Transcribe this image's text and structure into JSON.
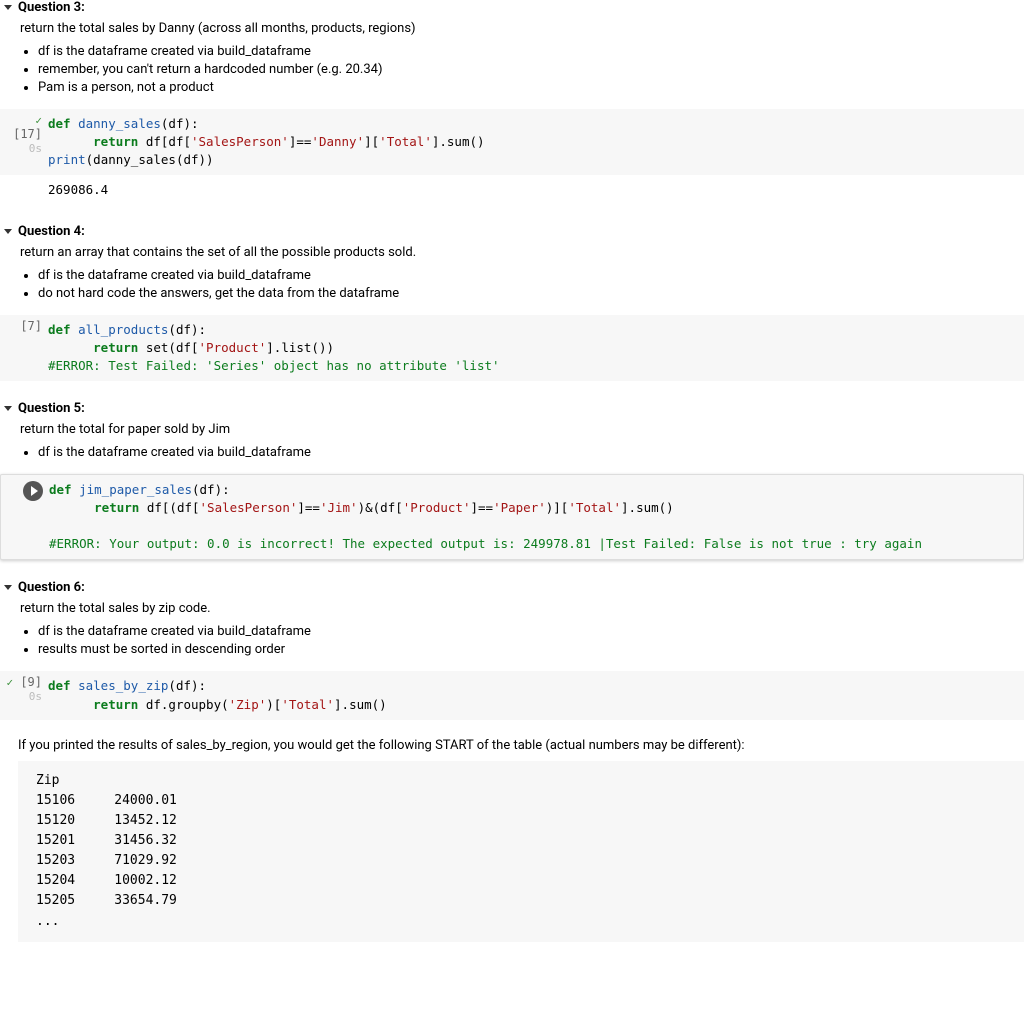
{
  "q3": {
    "title": "Question 3:",
    "desc": "return the total sales by Danny (across all months, products, regions)",
    "bullets": [
      "df is the dataframe created via build_dataframe",
      "remember, you can't return a hardcoded number (e.g. 20.34)",
      "Pam is a person, not a product"
    ],
    "prompt": "[17]",
    "subtime": "0s",
    "code_def": "def",
    "code_fn": "danny_sales",
    "code_sig": "(df):",
    "code_ret": "return",
    "code_body1a": " df[df[",
    "code_str1": "'SalesPerson'",
    "code_body1b": "]==",
    "code_str2": "'Danny'",
    "code_body1c": "][",
    "code_str3": "'Total'",
    "code_body1d": "].sum()",
    "code_print": "print",
    "code_print_body": "(danny_sales(df))",
    "output": "269086.4"
  },
  "q4": {
    "title": "Question 4:",
    "desc": "return an array that contains the set of all the possible products sold.",
    "bullets": [
      "df is the dataframe created via build_dataframe",
      "do not hard code the answers, get the data from the dataframe"
    ],
    "prompt": "[7]",
    "code_fn": "all_products",
    "code_body1a": " set(df[",
    "code_str1": "'Product'",
    "code_body1b": "].list())",
    "err": "#ERROR: Test Failed: 'Series' object has no attribute 'list'"
  },
  "q5": {
    "title": "Question 5:",
    "desc": "return the total for paper sold by Jim",
    "bullets": [
      "df is the dataframe created via build_dataframe"
    ],
    "code_fn": "jim_paper_sales",
    "code_body1a": " df[(df[",
    "code_str1": "'SalesPerson'",
    "code_body1b": "]==",
    "code_str2": "'Jim'",
    "code_body1c": ")&(df[",
    "code_str3": "'Product'",
    "code_body1d": "]==",
    "code_str4": "'Paper'",
    "code_body1e": ")][",
    "code_str5": "'Total'",
    "code_body1f": "].sum()",
    "err": "#ERROR: Your output: 0.0 is incorrect! The expected output is: 249978.81 |Test Failed: False is not true : try again"
  },
  "q6": {
    "title": "Question 6:",
    "desc": "return the total sales by zip code.",
    "bullets": [
      "df is the dataframe created via build_dataframe",
      "results must be sorted in descending order"
    ],
    "prompt": "[9]",
    "subtime": "0s",
    "code_fn": "sales_by_zip",
    "code_body1a": " df.groupby(",
    "code_str1": "'Zip'",
    "code_body1b": ")[",
    "code_str2": "'Total'",
    "code_body1c": "].sum()",
    "explain": "If you printed the results of sales_by_region, you would get the following START of the table (actual numbers may be different):",
    "out": "Zip\n15106     24000.01\n15120     13452.12\n15201     31456.32\n15203     71029.92\n15204     10002.12\n15205     33654.79\n..."
  }
}
